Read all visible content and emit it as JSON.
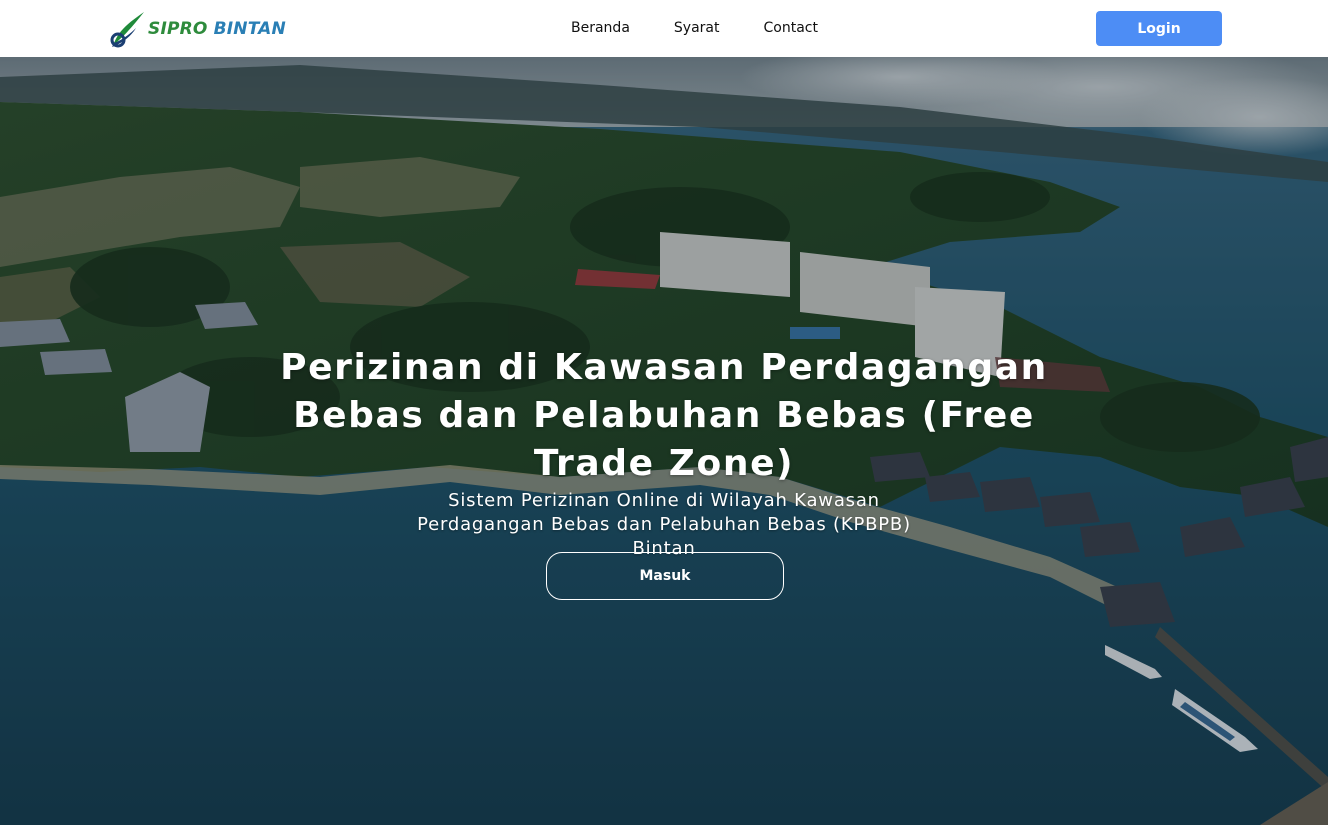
{
  "header": {
    "brand": {
      "word1": "SIPRO",
      "word2": "BINTAN"
    },
    "nav": [
      {
        "label": "Beranda"
      },
      {
        "label": "Syarat"
      },
      {
        "label": "Contact"
      }
    ],
    "login_label": "Login"
  },
  "hero": {
    "title": "Perizinan di Kawasan Perdagangan Bebas dan Pelabuhan Bebas (Free Trade Zone)",
    "subtitle": "Sistem Perizinan Online di Wilayah Kawasan Perdagangan Bebas dan Pelabuhan Bebas (KPBPB) Bintan",
    "cta_label": "Masuk",
    "background": "aerial-photo-resort-coast"
  },
  "colors": {
    "brand_green": "#2e8b3c",
    "brand_blue": "#2a7fb5",
    "login_button": "#4d8df5",
    "nav_text": "#111111"
  }
}
